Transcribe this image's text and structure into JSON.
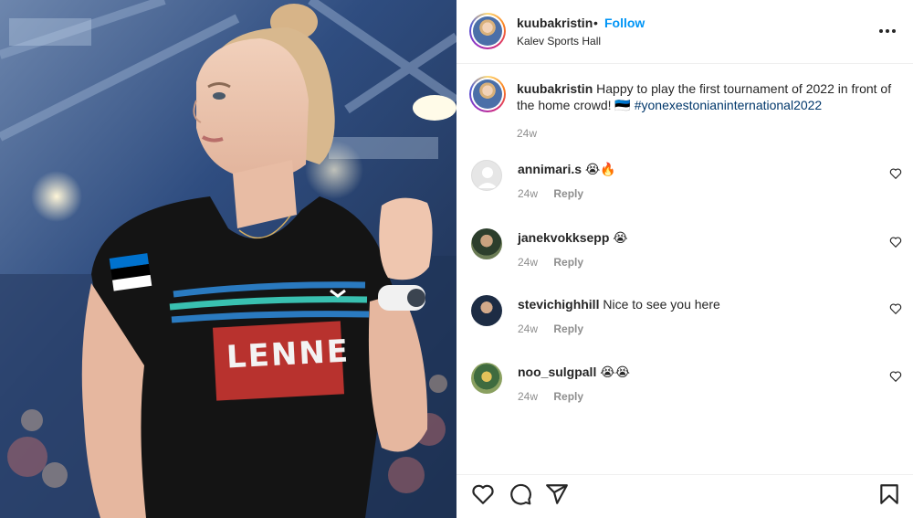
{
  "post": {
    "username": "kuubakristin",
    "separator": "•",
    "follow_label": "Follow",
    "location": "Kalev Sports Hall"
  },
  "photo": {
    "shirt_text": "LENNE",
    "flag_colors": [
      "#0072ce",
      "#000000",
      "#ffffff"
    ],
    "shirt_color": "#141414",
    "stripe_colors": [
      "#2a7ac0",
      "#39c0b0"
    ]
  },
  "caption": {
    "username": "kuubakristin",
    "text": "Happy to play the first tournament of 2022 in front of the home crowd! 🇪🇪",
    "hashtag": "#yonexestonianinternational2022",
    "time": "24w"
  },
  "comments": [
    {
      "username": "annimari.s",
      "text": "😭🔥",
      "time": "24w",
      "reply_label": "Reply"
    },
    {
      "username": "janekvokksepp",
      "text": "😭",
      "time": "24w",
      "reply_label": "Reply"
    },
    {
      "username": "stevichighhill",
      "text": "Nice to see you here",
      "time": "24w",
      "reply_label": "Reply"
    },
    {
      "username": "noo_sulgpall",
      "text": "😭😭",
      "time": "24w",
      "reply_label": "Reply"
    }
  ],
  "icons": {
    "more": "more-options-icon",
    "like": "heart-icon",
    "comment": "comment-icon",
    "share": "paper-plane-icon",
    "save": "bookmark-icon"
  },
  "colors": {
    "link_blue": "#0095f6",
    "hashtag": "#00376b",
    "muted": "#8e8e8e"
  }
}
